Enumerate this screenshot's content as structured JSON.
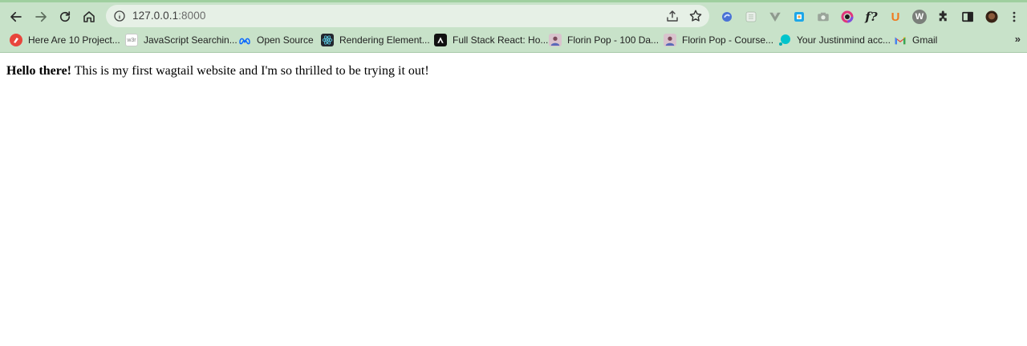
{
  "toolbar": {
    "url_host": "127.0.0.1",
    "url_port": ":8000",
    "back_icon": "arrow-left-icon",
    "forward_icon": "arrow-right-icon",
    "reload_icon": "reload-icon",
    "home_icon": "home-icon"
  },
  "extensions": {
    "fx_label": "f?",
    "u_label": "U",
    "w_label": "W"
  },
  "bookmarks": [
    {
      "label": "Here Are 10 Project...",
      "fav_color": "#e8453c"
    },
    {
      "label": "JavaScript Searchin...",
      "fav_text": "w3r",
      "fav_color": "#ffffff"
    },
    {
      "label": "Open Source",
      "fav_color": "#0866ff"
    },
    {
      "label": "Rendering Element...",
      "fav_color": "#23272f"
    },
    {
      "label": "Full Stack React: Ho...",
      "fav_color": "#111111"
    },
    {
      "label": "Florin Pop - 100 Da...",
      "fav_color": "#b46a8a"
    },
    {
      "label": "Florin Pop - Course...",
      "fav_color": "#b46a8a"
    },
    {
      "label": "Your Justinmind acc...",
      "fav_color": "#00c4cc"
    },
    {
      "label": "Gmail",
      "fav_text": "M",
      "fav_color": "#ffffff"
    }
  ],
  "bookmarks_more": "»",
  "page": {
    "bold": "Hello there!",
    "rest": " This is my first wagtail website and I'm so thrilled to be trying it out!"
  }
}
